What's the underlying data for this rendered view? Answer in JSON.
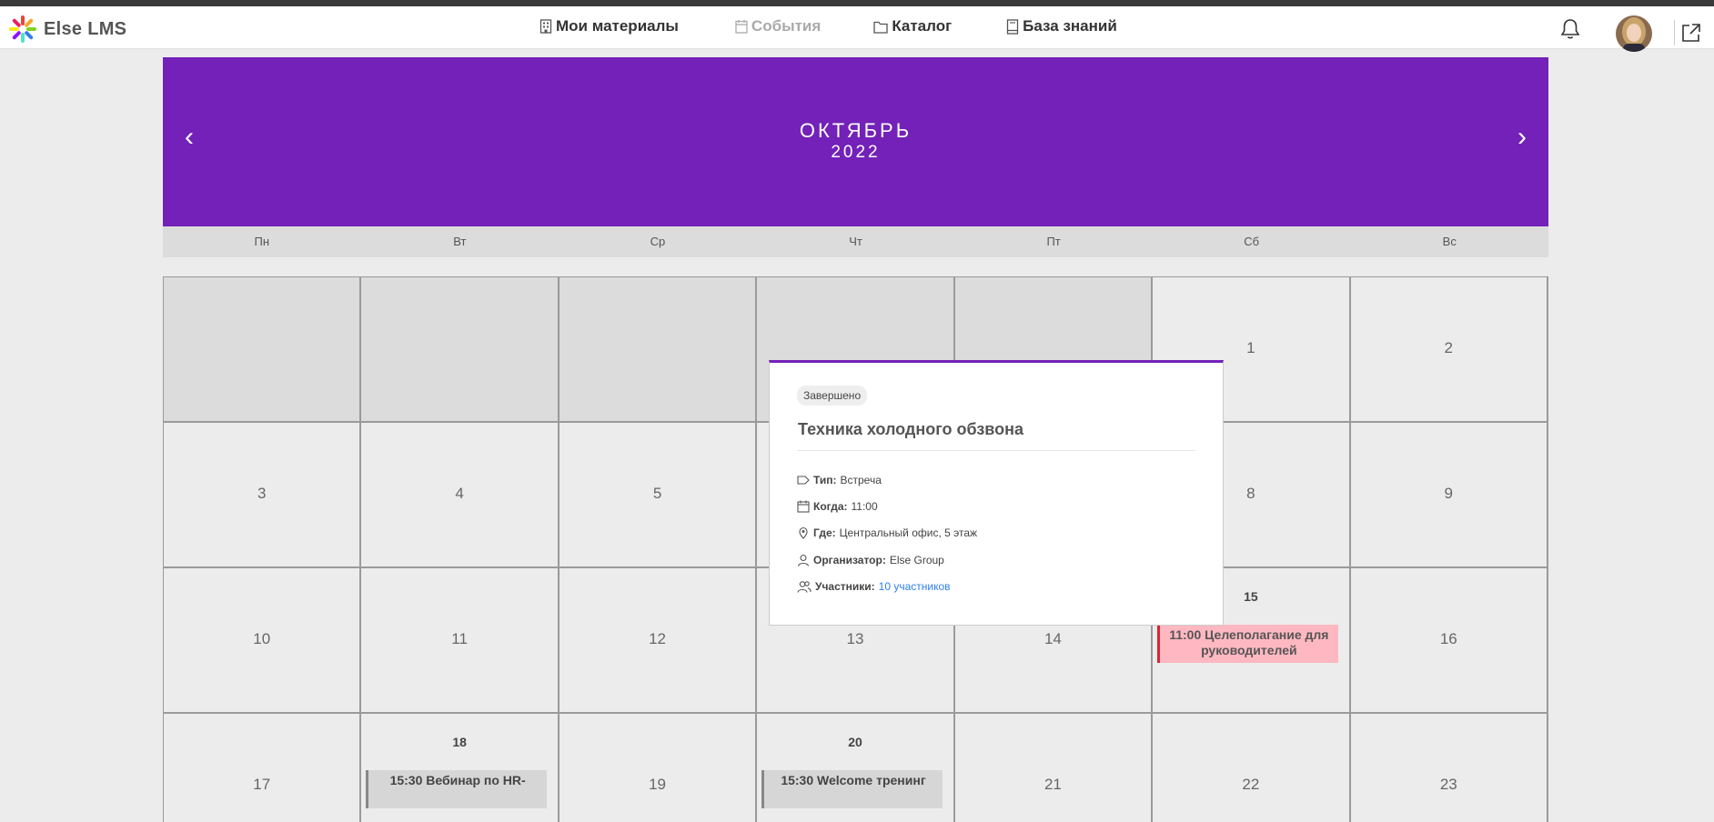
{
  "app": {
    "logo_text": "Else LMS"
  },
  "nav": {
    "items": [
      {
        "label": "Мои материалы",
        "icon": "building-icon"
      },
      {
        "label": "События",
        "icon": "calendar-icon"
      },
      {
        "label": "Каталог",
        "icon": "folder-icon"
      },
      {
        "label": "База знаний",
        "icon": "book-icon"
      }
    ],
    "active_muted": "События"
  },
  "header_icons": [
    "bell-icon",
    "avatar",
    "external-link-icon"
  ],
  "calendar": {
    "month": "ОКТЯБРЬ",
    "year": "2022",
    "prev_label": "‹",
    "next_label": "›",
    "weekdays": [
      "Пн",
      "Вт",
      "Ср",
      "Чт",
      "Пт",
      "Сб",
      "Вс"
    ],
    "days": [
      "1",
      "2",
      "3",
      "4",
      "5",
      "8",
      "9",
      "10",
      "11",
      "12",
      "13",
      "14",
      "15",
      "16",
      "17",
      "18",
      "19",
      "20",
      "21",
      "22",
      "23"
    ],
    "events": [
      {
        "day": "15",
        "text": "11:00 Целеполагание для руководителей",
        "color": "#ffb8c1",
        "accent": "#e02233"
      },
      {
        "day": "18",
        "text": "15:30 Вебинар по HR-",
        "color": "#d6d6d6",
        "accent": "#888888"
      },
      {
        "day": "20",
        "text": "15:30 Welcome тренинг",
        "color": "#d6d6d6",
        "accent": "#888888"
      }
    ]
  },
  "popup": {
    "status": "Завершено",
    "title": "Техника холодного обзвона",
    "type_label": "Тип:",
    "type_value": "Встреча",
    "when_label": "Когда:",
    "when_value": "11:00",
    "where_label": "Где:",
    "where_value": "Центральный офис, 5 этаж",
    "organizer_label": "Организатор:",
    "organizer_value": "Else Group",
    "participants_label": "Участники:",
    "participants_value": "10 участников"
  },
  "colors": {
    "accent": "#7321b8",
    "link": "#2f80ed"
  }
}
